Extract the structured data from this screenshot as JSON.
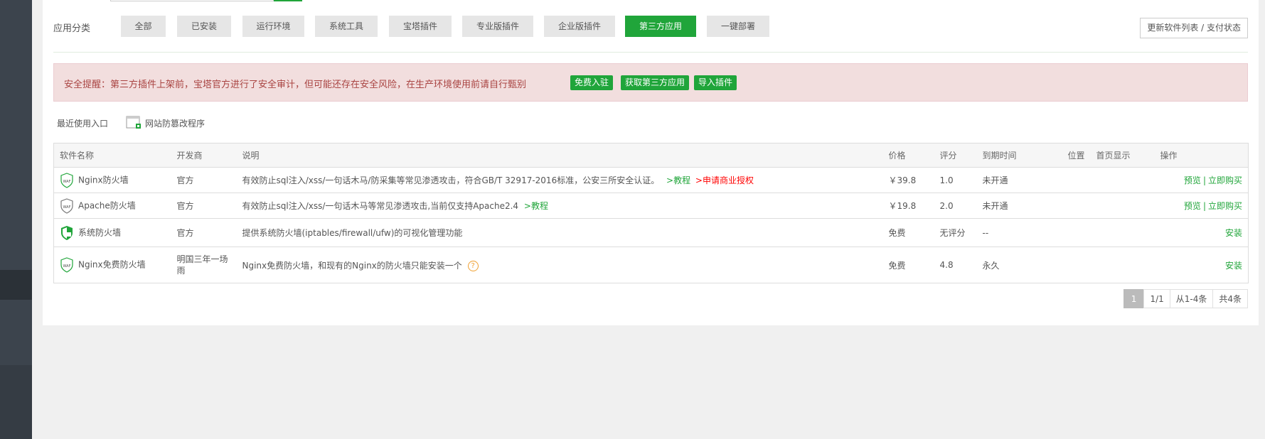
{
  "categories": {
    "label": "应用分类",
    "items": [
      {
        "label": "全部"
      },
      {
        "label": "已安装"
      },
      {
        "label": "运行环境"
      },
      {
        "label": "系统工具"
      },
      {
        "label": "宝塔插件"
      },
      {
        "label": "专业版插件"
      },
      {
        "label": "企业版插件"
      },
      {
        "label": "第三方应用",
        "active": true
      },
      {
        "label": "一键部署"
      }
    ],
    "update_button": "更新软件列表 / 支付状态"
  },
  "alert": {
    "text": "安全提醒：第三方插件上架前，宝塔官方进行了安全审计，但可能还存在安全风险，在生产环境使用前请自行甄别",
    "buttons": [
      "免费入驻",
      "获取第三方应用",
      "导入插件"
    ]
  },
  "recent": {
    "label": "最近使用入口",
    "app": "网站防篡改程序"
  },
  "table": {
    "headers": {
      "name": "软件名称",
      "developer": "开发商",
      "desc": "说明",
      "price": "价格",
      "rating": "评分",
      "expire": "到期时间",
      "position": "位置",
      "homepage": "首页显示",
      "action": "操作"
    },
    "rows": [
      {
        "icon": "waf-shield-icon",
        "name": "Nginx防火墙",
        "developer": "官方",
        "desc": "有效防止sql注入/xss/一句话木马/防采集等常见渗透攻击，符合GB/T 32917-2016标准，公安三所安全认证。",
        "desc_link1": ">教程",
        "desc_link2": ">申请商业授权",
        "price": "￥39.8",
        "rating": "1.0",
        "expire": "未开通",
        "action1": "预览",
        "action_sep": "|",
        "action2": "立即购买"
      },
      {
        "icon": "waf-shield-icon",
        "name": "Apache防火墙",
        "developer": "官方",
        "desc": "有效防止sql注入/xss/一句话木马等常见渗透攻击,当前仅支持Apache2.4",
        "desc_link1": ">教程",
        "price": "￥19.8",
        "rating": "2.0",
        "expire": "未开通",
        "action1": "预览",
        "action_sep": "|",
        "action2": "立即购买"
      },
      {
        "icon": "system-firewall-icon",
        "name": "系统防火墙",
        "developer": "官方",
        "desc": "提供系统防火墙(iptables/firewall/ufw)的可视化管理功能",
        "price": "免费",
        "rating": "无评分",
        "expire": "--",
        "action2": "安装"
      },
      {
        "icon": "waf-shield-icon",
        "name": "Nginx免费防火墙",
        "developer": "明国三年一场雨",
        "desc": "Nginx免费防火墙，和现有的Nginx的防火墙只能安装一个",
        "help": "?",
        "price": "免费",
        "rating": "4.8",
        "expire": "永久",
        "action2": "安装"
      }
    ]
  },
  "pager": {
    "current": "1",
    "pages": "1/1",
    "range": "从1-4条",
    "total": "共4条"
  },
  "colors": {
    "accent": "#20a53a",
    "price": "#ff5722",
    "alert_text": "#a94442",
    "alert_bg": "#f2dede",
    "sidebar": "#3c444d"
  }
}
